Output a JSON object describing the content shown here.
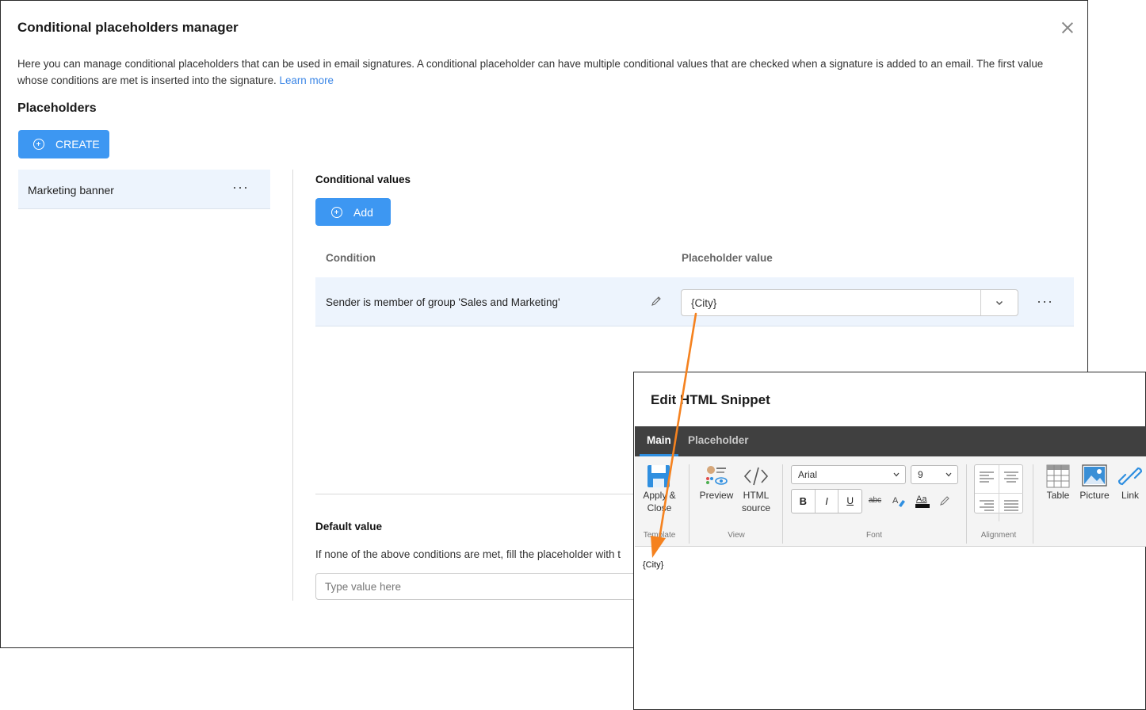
{
  "dialog": {
    "title": "Conditional placeholders manager",
    "description": "Here you can manage conditional placeholders that can be used in email signatures. A conditional placeholder can have multiple conditional values that are checked when a signature is added to an email. The first value whose conditions are met is inserted into the signature.",
    "learn_more": "Learn more",
    "placeholders_heading": "Placeholders",
    "create_label": "CREATE",
    "placeholders": [
      {
        "label": "Marketing banner",
        "menu": "···"
      }
    ],
    "conditional_values": {
      "heading": "Conditional values",
      "add_label": "Add",
      "columns": [
        "Condition",
        "Placeholder value"
      ],
      "rows": [
        {
          "condition": "Sender is member of group 'Sales and Marketing'",
          "value": "{City}",
          "menu": "···"
        }
      ]
    },
    "default_value": {
      "heading": "Default value",
      "description": "If none of the above conditions are met, fill the placeholder with t",
      "placeholder": "Type value here"
    }
  },
  "snippet": {
    "title": "Edit HTML Snippet",
    "tabs": [
      "Main",
      "Placeholder"
    ],
    "active_tab": "Main",
    "ribbon": {
      "apply_close": [
        "Apply &",
        "Close"
      ],
      "template_group": "Template",
      "preview": "Preview",
      "html_source": [
        "HTML",
        "source"
      ],
      "view_group": "View",
      "font_name": "Arial",
      "font_size": "9",
      "bold": "B",
      "italic": "I",
      "underline": "U",
      "strike": "abc",
      "font_group": "Font",
      "alignment_group": "Alignment",
      "table": "Table",
      "picture": "Picture",
      "link": "Link"
    },
    "editor_content": "{City}"
  },
  "colors": {
    "primary": "#3d97f2",
    "link": "#3b86e6",
    "row_highlight": "#edf4fd",
    "arrow": "#f5821f",
    "tabbar": "#404040"
  }
}
